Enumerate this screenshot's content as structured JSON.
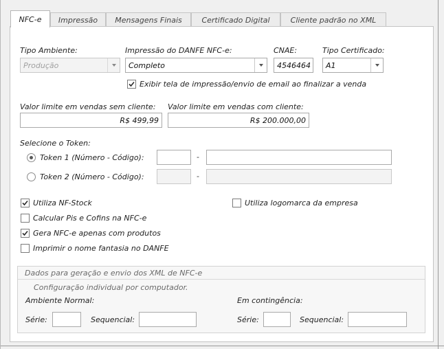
{
  "tabs": [
    {
      "label": "NFC-e",
      "active": true
    },
    {
      "label": "Impressão",
      "active": false
    },
    {
      "label": "Mensagens Finais",
      "active": false
    },
    {
      "label": "Certificado Digital",
      "active": false
    },
    {
      "label": "Cliente padrão no XML",
      "active": false
    }
  ],
  "ambiente": {
    "label": "Tipo Ambiente:",
    "value": "Produção",
    "enabled": false
  },
  "impressao_danfe": {
    "label": "Impressão do DANFE NFC-e:",
    "value": "Completo"
  },
  "cnae": {
    "label": "CNAE:",
    "value": "4546464"
  },
  "tipo_certificado": {
    "label": "Tipo Certificado:",
    "value": "A1"
  },
  "exibir_tela": {
    "label": "Exibir tela de impressão/envio de email ao finalizar a venda",
    "checked": true
  },
  "limite_sem_cliente": {
    "label": "Valor limite em vendas sem cliente:",
    "value": "R$ 499,99"
  },
  "limite_com_cliente": {
    "label": "Valor limite em vendas com cliente:",
    "value": "R$ 200.000,00"
  },
  "token": {
    "label": "Selecione o Token:",
    "separator": "-",
    "options": [
      {
        "label": "Token 1 (Número - Código):",
        "selected": true,
        "numero": "",
        "codigo": ""
      },
      {
        "label": "Token 2 (Número - Código):",
        "selected": false,
        "numero": "",
        "codigo": ""
      }
    ]
  },
  "options": {
    "nf_stock": {
      "label": "Utiliza NF-Stock",
      "checked": true
    },
    "logomarca": {
      "label": "Utiliza logomarca da empresa",
      "checked": false
    },
    "pis_cofins": {
      "label": "Calcular Pis e Cofins na NFC-e",
      "checked": false
    },
    "gera_nfce_produtos": {
      "label": "Gera NFC-e apenas com produtos",
      "checked": true
    },
    "nome_fantasia": {
      "label": "Imprimir o nome fantasia no DANFE",
      "checked": false
    }
  },
  "xml_group": {
    "title": "Dados para geração e envio dos XML de NFC-e",
    "subtitle": "Configuração individual por computador.",
    "normal": {
      "label": "Ambiente Normal:",
      "serie_label": "Série:",
      "serie": "",
      "seq_label": "Sequencial:",
      "seq": ""
    },
    "contingencia": {
      "label": "Em contingência:",
      "serie_label": "Série:",
      "serie": "",
      "seq_label": "Sequencial:",
      "seq": ""
    }
  },
  "colors": {
    "panel": "#ffffff",
    "frame": "#f0f0f0",
    "check": "#2b2b2b"
  }
}
